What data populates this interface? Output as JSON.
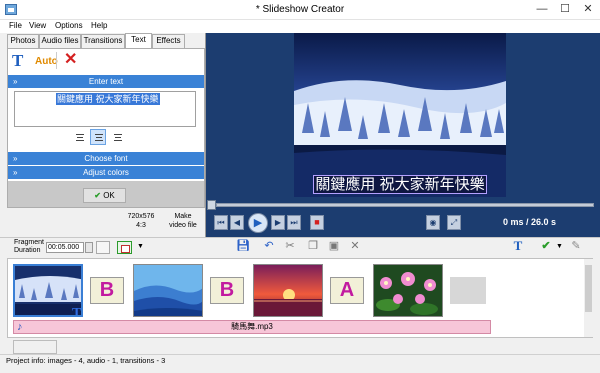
{
  "window": {
    "title": "* Slideshow Creator",
    "min": "—",
    "max": "☐",
    "close": "✕"
  },
  "menu": [
    "File",
    "View",
    "Options",
    "Help"
  ],
  "tabs": [
    "Photos",
    "Audio files",
    "Transitions",
    "Text",
    "Effects"
  ],
  "active_tab": "Text",
  "text_panel": {
    "text_icon": "T",
    "auto_label": "Auto",
    "delete_icon": "✕",
    "enter_text_header": "Enter text",
    "text_value": "關鍵應用 祝大家新年快樂",
    "choose_font_header": "Choose font",
    "adjust_colors_header": "Adjust colors",
    "ok_label": "OK",
    "ok_icon": "✔"
  },
  "resolution": {
    "size": "720x576",
    "ratio": "4:3"
  },
  "make_video": {
    "line1": "Make",
    "line2": "video file"
  },
  "preview": {
    "caption": "關鍵應用 祝大家新年快樂",
    "time": "0 ms  / 26.0 s"
  },
  "toolbar": {
    "fragment_label_1": "Fragment",
    "fragment_label_2": "Duration",
    "fragment_value": "00:05.000"
  },
  "timeline": {
    "transitions": [
      "B",
      "B",
      "A"
    ],
    "audio_file": "騎馬舞.mp3"
  },
  "status": "Project info: images - 4, audio - 1, transitions - 3",
  "colors": {
    "accent": "#3a82d6",
    "preview_bg": "#1c3d70",
    "audio_track": "#f7c6d8"
  }
}
